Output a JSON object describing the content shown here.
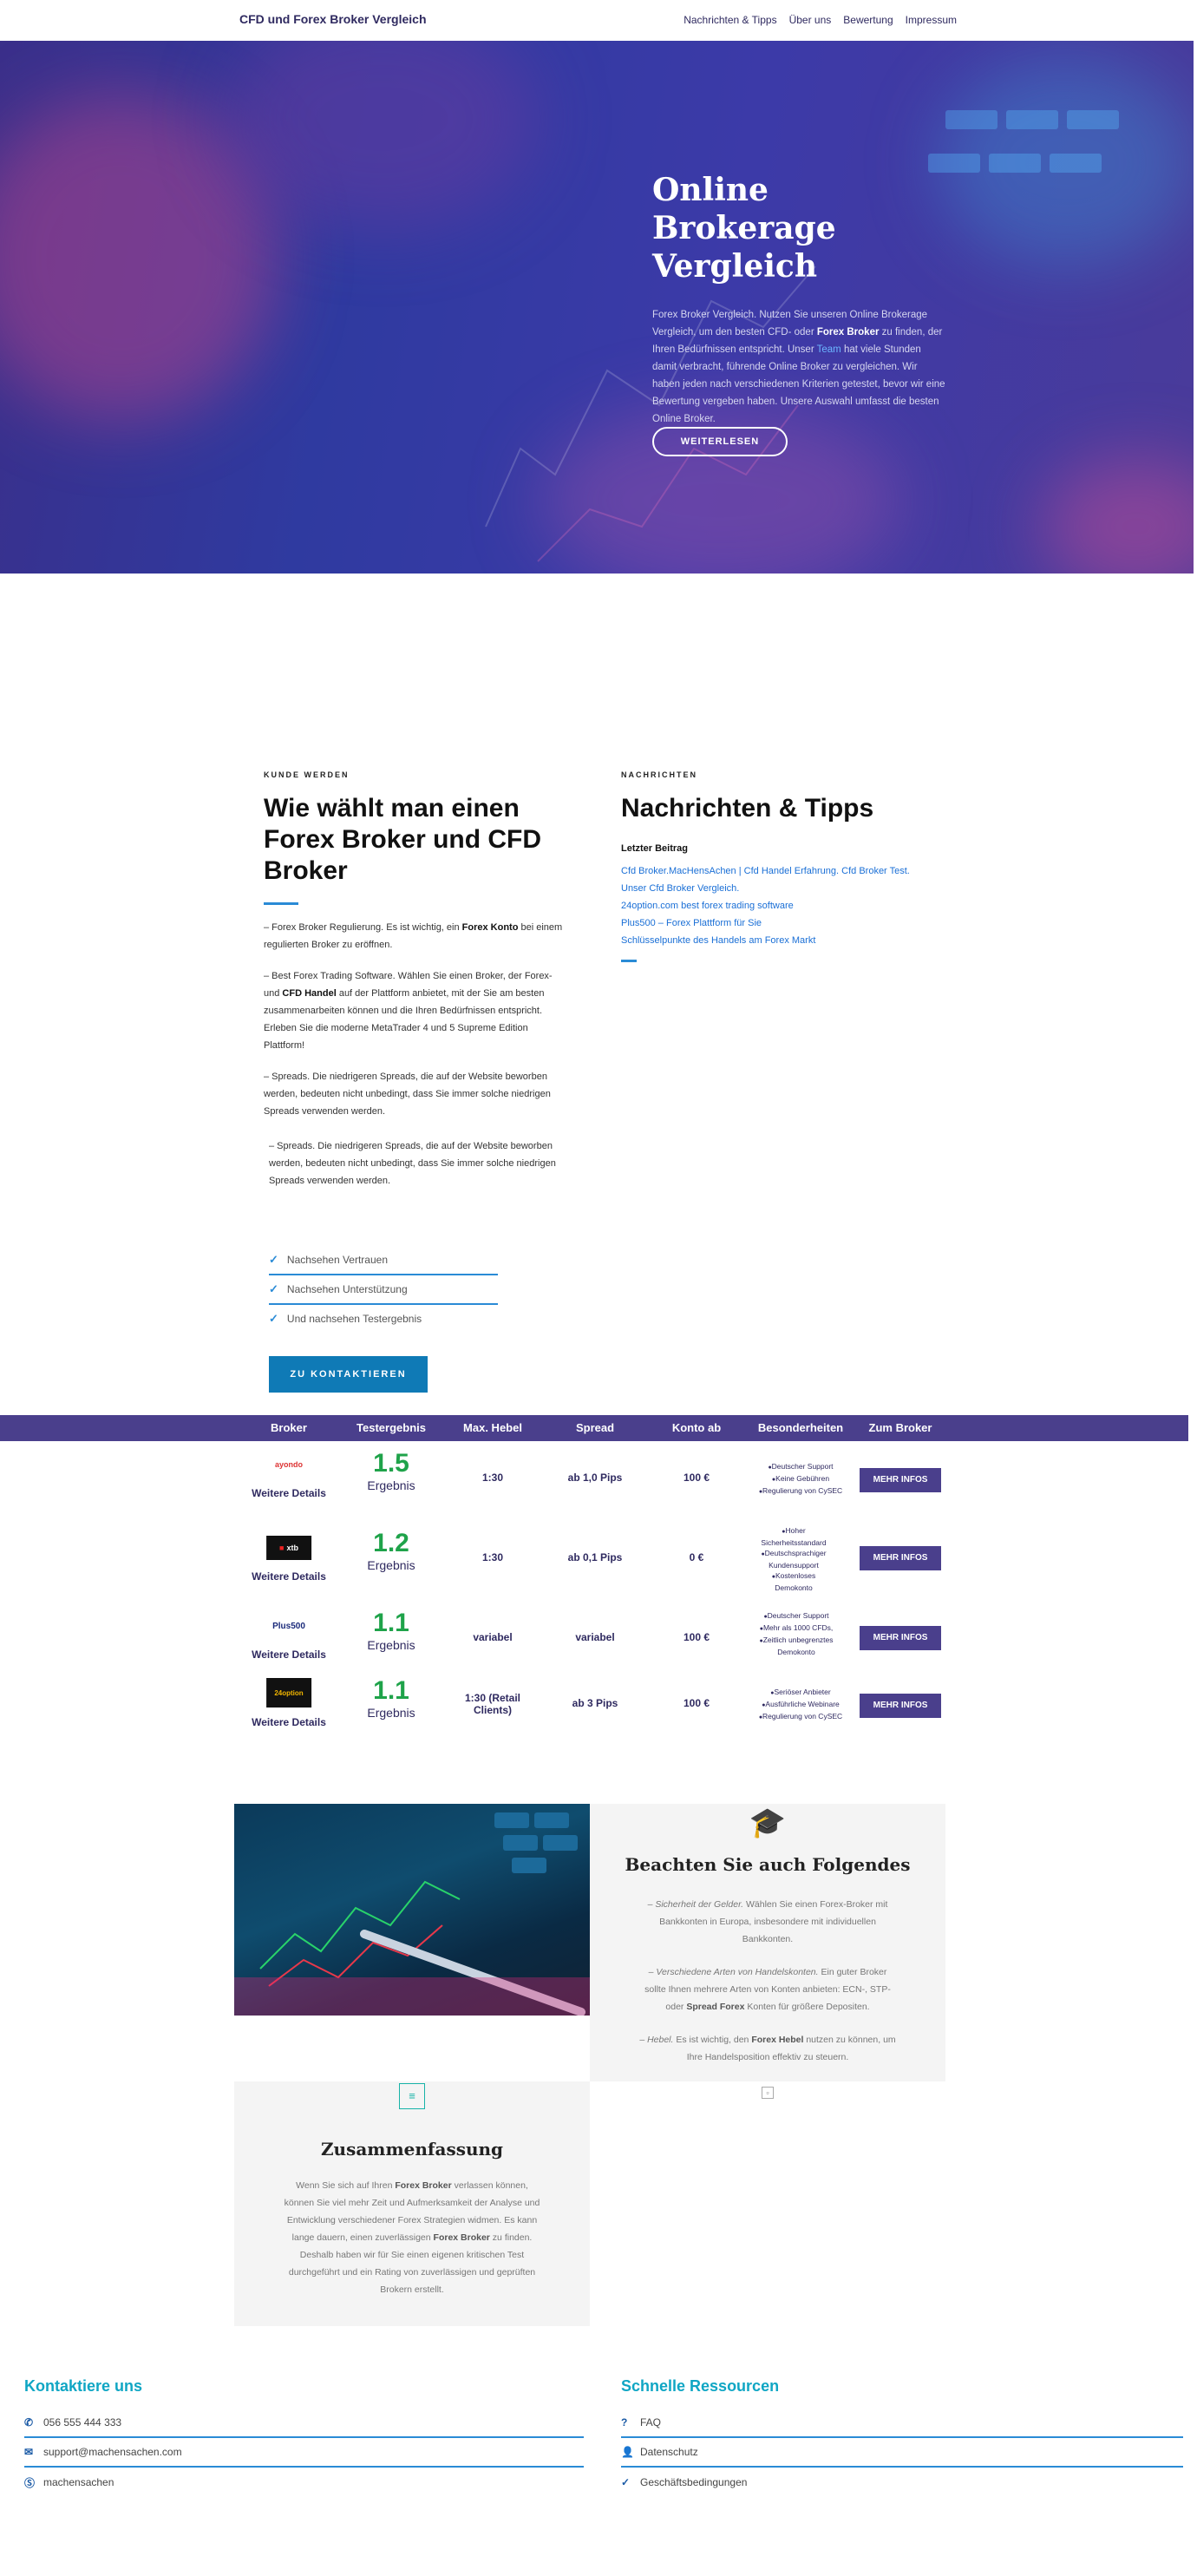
{
  "header": {
    "site_title": "CFD und Forex Broker Vergleich",
    "nav": [
      "Nachrichten & Tipps",
      "Über uns",
      "Bewertung",
      "Impressum"
    ]
  },
  "hero": {
    "title": "Online Brokerage Vergleich",
    "desc_1": "Forex Broker Vergleich. Nutzen Sie unseren Online Brokerage Vergleich, um den besten CFD- oder ",
    "desc_bold": "Forex Broker",
    "desc_2": " zu finden, der Ihren Bedürfnissen entspricht. Unser ",
    "desc_link": "Team",
    "desc_3": " hat viele Stunden damit verbracht, führende Online Broker zu vergleichen. Wir haben jeden nach verschiedenen Kriterien getestet, bevor wir eine Bewertung vergeben haben. Unsere Auswahl umfasst die besten Online Broker.",
    "button": "WEITERLESEN"
  },
  "left": {
    "kicker": "KUNDE WERDEN",
    "title": "Wie wählt man einen Forex Broker und CFD Broker",
    "p1_a": "– Forex Broker Regulierung. Es ist wichtig, ein ",
    "p1_b": "Forex Konto",
    "p1_c": " bei einem regulierten Broker zu eröffnen.",
    "p2_a": "– Best Forex Trading Software.  Wählen Sie einen Broker, der Forex- und ",
    "p2_b": "CFD Handel",
    "p2_c": " auf der Plattform anbietet, mit der Sie am besten zusammenarbeiten können und die Ihren Bedürfnissen entspricht. Erleben Sie die moderne MetaTrader 4 und 5 Supreme Edition Plattform!",
    "p3": "– Spreads. Die niedrigeren Spreads, die auf der Website beworben werden, bedeuten nicht unbedingt, dass Sie immer solche niedrigen Spreads verwenden werden.",
    "p4": "– Spreads. Die niedrigeren Spreads, die auf der Website beworben werden, bedeuten nicht unbedingt, dass Sie immer solche niedrigen Spreads verwenden werden.",
    "checks": [
      "Nachsehen Vertrauen",
      "Nachsehen Unterstützung",
      "Und nachsehen Testergebnis"
    ],
    "button": "ZU KONTAKTIEREN"
  },
  "right": {
    "kicker": "NACHRICHTEN",
    "title": "Nachrichten & Tipps",
    "subtitle": "Letzter Beitrag",
    "links": [
      "Cfd Broker.MacHensAchen | Cfd Handel Erfahrung. Cfd Broker Test.",
      "Unser Cfd Broker Vergleich.",
      "24option.com best forex trading software",
      "Plus500 – Forex Plattform für Sie",
      "Schlüsselpunkte des Handels am Forex Markt"
    ]
  },
  "table": {
    "headers": [
      "Broker",
      "Testergebnis",
      "Max. Hebel",
      "Spread",
      "Konto ab",
      "Besonderheiten",
      "Zum Broker"
    ],
    "rows": [
      {
        "logo": "ayondo",
        "details": "Weitere Details",
        "score": "1.5",
        "score_label": "Ergebnis",
        "hebel": "1:30",
        "spread": "ab 1,0 Pips",
        "konto": "100 €",
        "features": [
          "Deutscher Support",
          "Keine Gebühren",
          "Regulierung von CySEC"
        ],
        "button": "MEHR INFOS"
      },
      {
        "logo": "xtb",
        "details": "Weitere Details",
        "score": "1.2",
        "score_label": "Ergebnis",
        "hebel": "1:30",
        "spread": "ab 0,1 Pips",
        "konto": "0 €",
        "features": [
          "Hoher Sicherheitsstandard",
          "Deutschsprachiger Kundensupport",
          "Kostenloses Demokonto"
        ],
        "button": "MEHR INFOS"
      },
      {
        "logo": "Plus500",
        "details": "Weitere Details",
        "score": "1.1",
        "score_label": "Ergebnis",
        "hebel": "variabel",
        "spread": "variabel",
        "konto": "100 €",
        "features": [
          "Deutscher Support",
          "Mehr als 1000 CFDs,",
          "Zeitlich unbegrenztes Demokonto"
        ],
        "button": "MEHR INFOS"
      },
      {
        "logo": "24option",
        "details": "Weitere Details",
        "score": "1.1",
        "score_label": "Ergebnis",
        "hebel": "1:30 (Retail Clients)",
        "spread": "ab 3 Pips",
        "konto": "100 €",
        "features": [
          "Seriöser Anbieter",
          "Ausführliche Webinare",
          "Regulierung von CySEC"
        ],
        "button": "MEHR INFOS"
      }
    ]
  },
  "beachten": {
    "title": "Beachten Sie auch Folgendes",
    "t1_a": "– ",
    "t1_i": "Sicherheit der Gelder.",
    "t1_b": " Wählen Sie einen Forex-Broker mit Bankkonten in Europa, insbesondere mit individuellen Bankkonten.",
    "t2_a": "– ",
    "t2_i": "Verschiedene Arten von Handelskonten.",
    "t2_b": " Ein guter Broker sollte Ihnen mehrere Arten von Konten anbieten: ECN-, STP- oder ",
    "t2_c": "Spread Forex",
    "t2_d": " Konten für größere Depositen.",
    "t3_a": "– ",
    "t3_i": "Hebel.",
    "t3_b": " Es ist wichtig, den ",
    "t3_c": "Forex Hebel",
    "t3_d": " nutzen zu können, um Ihre Handelsposition effektiv zu steuern."
  },
  "summary": {
    "title": "Zusammenfassung",
    "a": "Wenn Sie sich auf Ihren ",
    "b": "Forex Broker",
    "c": " verlassen können, können Sie viel mehr Zeit und Aufmerksamkeit der Analyse und Entwicklung verschiedener Forex Strategien widmen. Es kann lange dauern, einen zuverlässigen ",
    "d": "Forex Broker",
    "e": " zu finden. Deshalb haben wir für Sie einen eigenen kritischen Test durchgeführt und ein Rating von zuverlässigen und geprüften Brokern erstellt."
  },
  "footer": {
    "contact_title": "Kontaktiere uns",
    "phone": "056 555 444 333",
    "email": "support@machensachen.com",
    "skype": "machensachen",
    "res_title": "Schnelle Ressourcen",
    "faq": "FAQ",
    "privacy": "Datenschutz",
    "terms": "Geschäftsbedingungen"
  }
}
